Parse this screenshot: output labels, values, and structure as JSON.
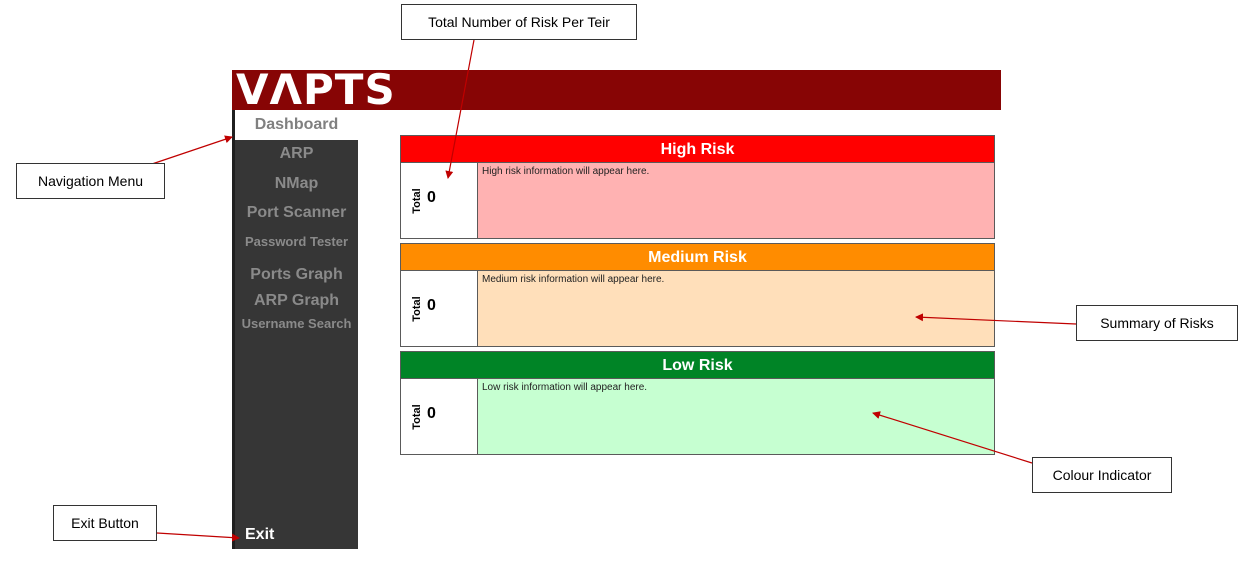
{
  "app": {
    "logo": "VΛPTS",
    "colors": {
      "header": "#870505",
      "sidebar": "#363636",
      "nav_text": "#8a8a8a",
      "exit_text": "#ffffff"
    }
  },
  "sidebar": {
    "items": [
      {
        "label": "Dashboard",
        "active": true
      },
      {
        "label": "ARP"
      },
      {
        "label": "NMap"
      },
      {
        "label": "Port Scanner"
      },
      {
        "label": "Password Tester"
      },
      {
        "label": "Ports Graph"
      },
      {
        "label": "ARP Graph"
      },
      {
        "label": "Username Search"
      }
    ],
    "exit_label": "Exit"
  },
  "risks": [
    {
      "title": "High Risk",
      "total_label": "Total",
      "total": "0",
      "info": "High risk information will appear here.",
      "header_color": "#ff0000",
      "body_color": "#ffb2b2"
    },
    {
      "title": "Medium Risk",
      "total_label": "Total",
      "total": "0",
      "info": "Medium risk information will appear here.",
      "header_color": "#ff8c00",
      "body_color": "#ffdfba"
    },
    {
      "title": "Low Risk",
      "total_label": "Total",
      "total": "0",
      "info": "Low risk information will appear here.",
      "header_color": "#008426",
      "body_color": "#c6ffd1"
    }
  ],
  "annotations": {
    "total_per_tier": "Total Number of Risk Per Teir",
    "navigation_menu": "Navigation Menu",
    "summary_of_risks": "Summary of Risks",
    "colour_indicator": "Colour Indicator",
    "exit_button": "Exit Button",
    "arrow_color": "#c00000"
  }
}
